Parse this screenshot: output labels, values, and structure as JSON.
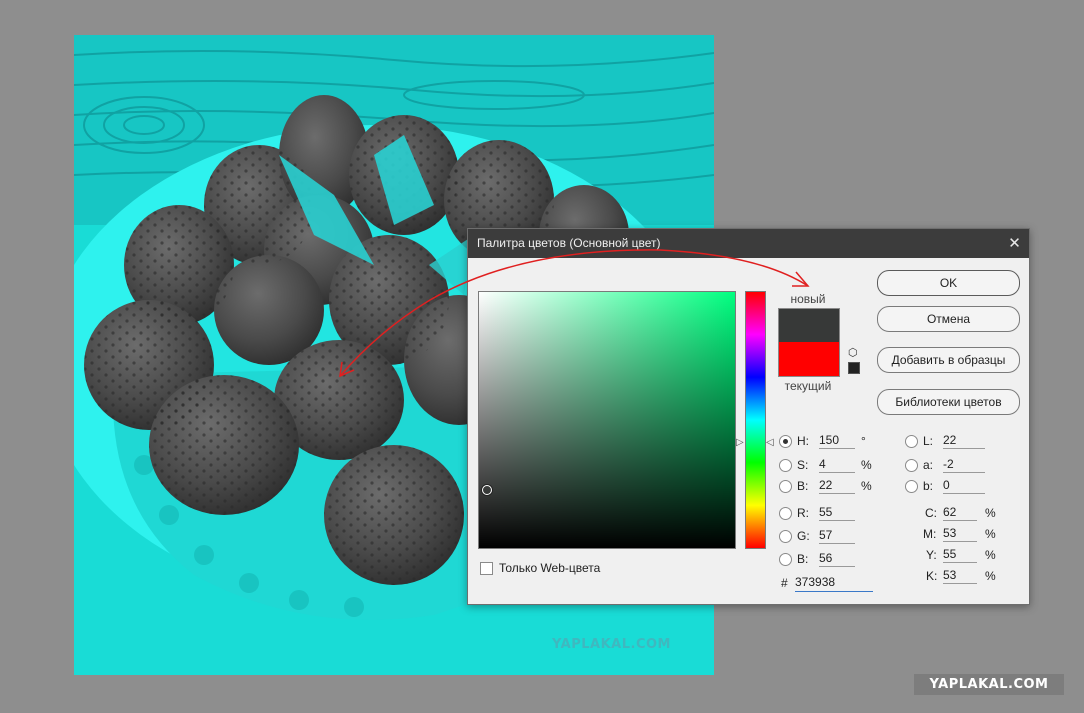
{
  "dialog": {
    "title": "Палитра цветов (Основной цвет)",
    "close_glyph": "✕",
    "new_label": "новый",
    "current_label": "текущий",
    "new_color": "#373938",
    "current_color": "#ff0000",
    "buttons": {
      "ok": "OK",
      "cancel": "Отмена",
      "add_to_swatches": "Добавить в образцы",
      "color_libraries": "Библиотеки цветов"
    },
    "hsb": [
      {
        "label": "H:",
        "value": "150",
        "unit": "°",
        "selected": true
      },
      {
        "label": "S:",
        "value": "4",
        "unit": "%",
        "selected": false
      },
      {
        "label": "B:",
        "value": "22",
        "unit": "%",
        "selected": false
      }
    ],
    "rgb": [
      {
        "label": "R:",
        "value": "55"
      },
      {
        "label": "G:",
        "value": "57"
      },
      {
        "label": "B:",
        "value": "56"
      }
    ],
    "lab": [
      {
        "label": "L:",
        "value": "22"
      },
      {
        "label": "a:",
        "value": "-2"
      },
      {
        "label": "b:",
        "value": "0"
      }
    ],
    "cmyk": [
      {
        "label": "C:",
        "value": "62",
        "unit": "%"
      },
      {
        "label": "M:",
        "value": "53",
        "unit": "%"
      },
      {
        "label": "Y:",
        "value": "55",
        "unit": "%"
      },
      {
        "label": "K:",
        "value": "53",
        "unit": "%"
      }
    ],
    "hex_symbol": "#",
    "hex_value": "373938",
    "web_only_label": "Только Web-цвета",
    "web_only_checked": false,
    "hue_color": "#00ff80"
  },
  "canvas": {
    "watermark": "YAPLAKAL.COM",
    "tint_color": "#19dcd6"
  },
  "corner_watermark": "YAPLAKAL.COM",
  "annotation_color": "#e02020"
}
